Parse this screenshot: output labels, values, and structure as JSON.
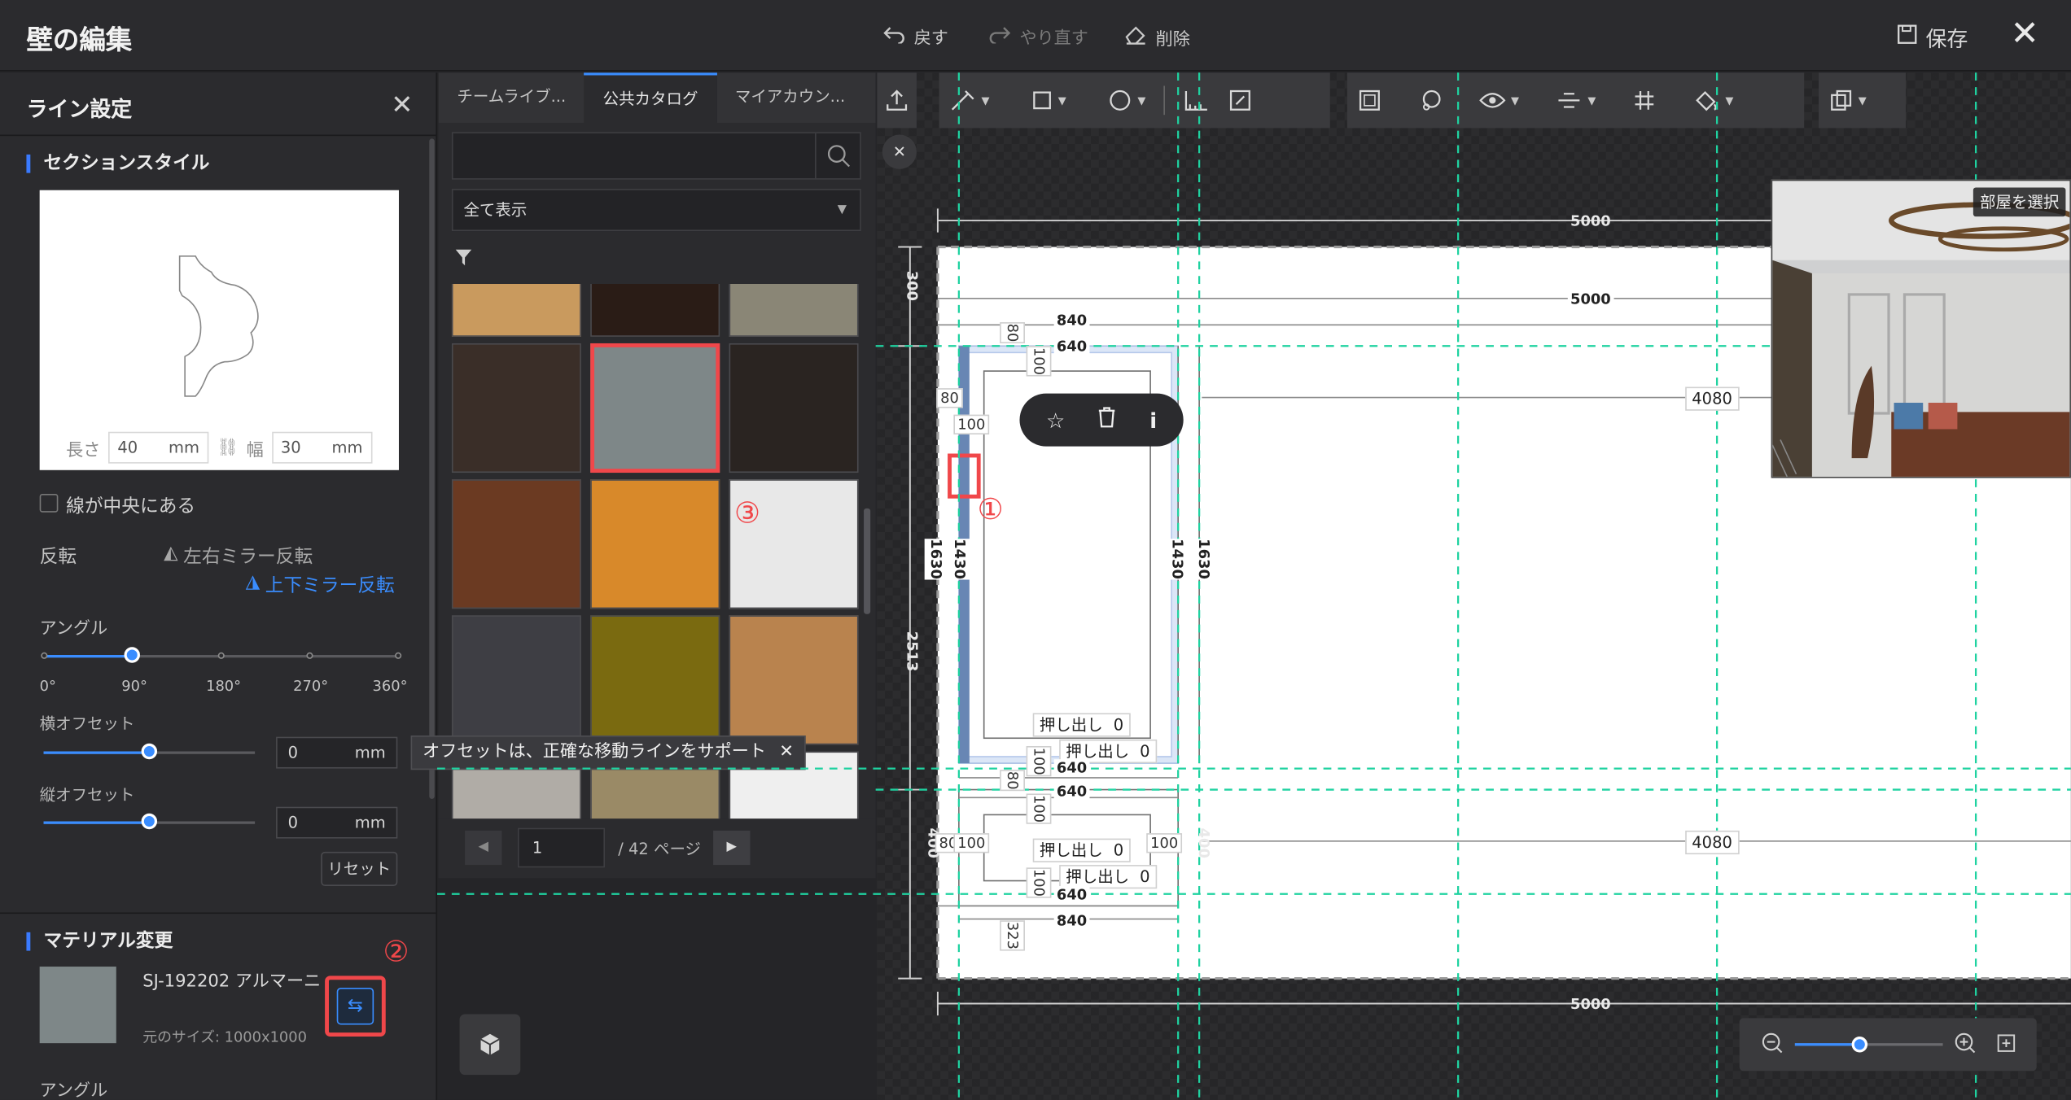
{
  "app": {
    "title": "壁の編集",
    "undo_label": "戻す",
    "redo_label": "やり直す",
    "delete_label": "削除",
    "save_label": "保存"
  },
  "line_settings": {
    "title": "ライン設定",
    "section_style": {
      "title": "セクションスタイル",
      "length_label": "長さ",
      "length_value": "40",
      "width_label": "幅",
      "width_value": "30",
      "unit": "mm"
    },
    "centered_checkbox_label": "線が中央にある",
    "flip": {
      "label": "反転",
      "horizontal_mirror": "左右ミラー反転",
      "vertical_mirror": "上下ミラー反転"
    },
    "angle": {
      "label": "アングル",
      "value_deg": 90,
      "ticks": [
        "0°",
        "90°",
        "180°",
        "270°",
        "360°"
      ]
    },
    "h_offset": {
      "label": "横オフセット",
      "value": "0",
      "unit": "mm",
      "slider_fraction": 0.5
    },
    "v_offset": {
      "label": "縦オフセット",
      "value": "0",
      "unit": "mm",
      "slider_fraction": 0.5
    },
    "reset_label": "リセット",
    "material": {
      "title": "マテリアル変更",
      "name": "SJ-192202 アルマーニ",
      "size_text": "元のサイズ: 1000x1000",
      "swatch_color": "#7e8788"
    },
    "material_angle_label": "アングル"
  },
  "tooltip": {
    "text": "オフセットは、正確な移動ラインをサポート"
  },
  "annotations": {
    "one": "①",
    "two": "②",
    "three": "③"
  },
  "catalog": {
    "tabs": [
      "チームライブ...",
      "公共カタログ",
      "マイアカウン..."
    ],
    "active_tab": 1,
    "search_placeholder": "",
    "filter_selected": "全て表示",
    "tiles": [
      {
        "color": "#c99a5e"
      },
      {
        "color": "#2a1c16"
      },
      {
        "color": "#8a8676"
      },
      {
        "color": "#3a2e28"
      },
      {
        "color": "#7e8788",
        "selected": true
      },
      {
        "color": "#2a2421"
      },
      {
        "color": "#6b3a22"
      },
      {
        "color": "#d8892a"
      },
      {
        "color": "#e8e8e8"
      },
      {
        "color": "#3e3e44"
      },
      {
        "color": "#7a6a10"
      },
      {
        "color": "#b9834e"
      },
      {
        "color": "#b0aca6"
      },
      {
        "color": "#9a8a66"
      },
      {
        "color": "#efefef"
      }
    ],
    "page_current": "1",
    "page_total_text": "/ 42 ページ"
  },
  "canvas": {
    "dimensions": {
      "top_total": "5000",
      "inner_total": "5000",
      "bottom_total": "5000",
      "left_height_top": "300",
      "left_height_total": "2513",
      "left_height_bottom": "400",
      "frame_outer_width": "840",
      "frame_inner_width": "640",
      "frame_height_outer": "1630",
      "frame_height_inner": "1430",
      "offset_80": "80",
      "offset_100": "100",
      "gap_323": "323",
      "right_span": "4080",
      "extrude_label": "押し出し",
      "extrude_value": "0"
    },
    "room_select_label": "部屋を選択",
    "accent_guide": "#1fd2a0"
  }
}
